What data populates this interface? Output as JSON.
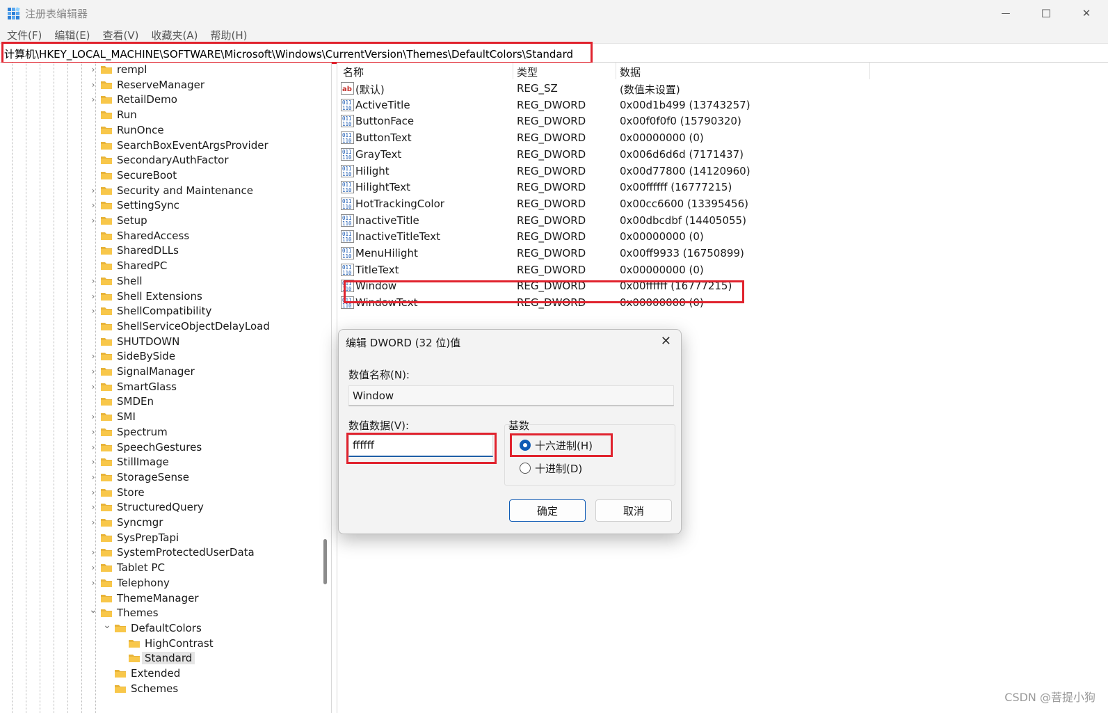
{
  "window": {
    "title": "注册表编辑器",
    "minimize_glyph": "—",
    "maximize_glyph": "☐",
    "close_glyph": "✕"
  },
  "menu": [
    {
      "label": "文件(F)"
    },
    {
      "label": "编辑(E)"
    },
    {
      "label": "查看(V)"
    },
    {
      "label": "收藏夹(A)"
    },
    {
      "label": "帮助(H)"
    }
  ],
  "address": {
    "path": "计算机\\HKEY_LOCAL_MACHINE\\SOFTWARE\\Microsoft\\Windows\\CurrentVersion\\Themes\\DefaultColors\\Standard"
  },
  "tree": [
    {
      "label": "rempl",
      "expander": "collapsed"
    },
    {
      "label": "ReserveManager",
      "expander": "collapsed"
    },
    {
      "label": "RetailDemo",
      "expander": "collapsed"
    },
    {
      "label": "Run",
      "expander": "none"
    },
    {
      "label": "RunOnce",
      "expander": "none"
    },
    {
      "label": "SearchBoxEventArgsProvider",
      "expander": "none"
    },
    {
      "label": "SecondaryAuthFactor",
      "expander": "none"
    },
    {
      "label": "SecureBoot",
      "expander": "none"
    },
    {
      "label": "Security and Maintenance",
      "expander": "collapsed"
    },
    {
      "label": "SettingSync",
      "expander": "collapsed"
    },
    {
      "label": "Setup",
      "expander": "collapsed"
    },
    {
      "label": "SharedAccess",
      "expander": "none"
    },
    {
      "label": "SharedDLLs",
      "expander": "none"
    },
    {
      "label": "SharedPC",
      "expander": "none"
    },
    {
      "label": "Shell",
      "expander": "collapsed"
    },
    {
      "label": "Shell Extensions",
      "expander": "collapsed"
    },
    {
      "label": "ShellCompatibility",
      "expander": "collapsed"
    },
    {
      "label": "ShellServiceObjectDelayLoad",
      "expander": "none"
    },
    {
      "label": "SHUTDOWN",
      "expander": "none"
    },
    {
      "label": "SideBySide",
      "expander": "collapsed"
    },
    {
      "label": "SignalManager",
      "expander": "collapsed"
    },
    {
      "label": "SmartGlass",
      "expander": "collapsed"
    },
    {
      "label": "SMDEn",
      "expander": "none"
    },
    {
      "label": "SMI",
      "expander": "collapsed"
    },
    {
      "label": "Spectrum",
      "expander": "collapsed"
    },
    {
      "label": "SpeechGestures",
      "expander": "collapsed"
    },
    {
      "label": "StillImage",
      "expander": "collapsed"
    },
    {
      "label": "StorageSense",
      "expander": "collapsed"
    },
    {
      "label": "Store",
      "expander": "collapsed"
    },
    {
      "label": "StructuredQuery",
      "expander": "collapsed"
    },
    {
      "label": "Syncmgr",
      "expander": "collapsed"
    },
    {
      "label": "SysPrepTapi",
      "expander": "none"
    },
    {
      "label": "SystemProtectedUserData",
      "expander": "collapsed"
    },
    {
      "label": "Tablet PC",
      "expander": "collapsed"
    },
    {
      "label": "Telephony",
      "expander": "collapsed"
    },
    {
      "label": "ThemeManager",
      "expander": "none"
    },
    {
      "label": "Themes",
      "expander": "expanded"
    },
    {
      "label": "DefaultColors",
      "expander": "expanded"
    },
    {
      "label": "HighContrast",
      "expander": "none"
    },
    {
      "label": "Standard",
      "expander": "none",
      "selected": true
    },
    {
      "label": "Extended",
      "expander": "none"
    },
    {
      "label": "Schemes",
      "expander": "none"
    }
  ],
  "list": {
    "columns": [
      {
        "label": "名称"
      },
      {
        "label": "类型"
      },
      {
        "label": "数据"
      }
    ],
    "rows": [
      {
        "icon": "string-value-icon",
        "name": "(默认)",
        "type": "REG_SZ",
        "data": "(数值未设置)"
      },
      {
        "icon": "dword-value-icon",
        "name": "ActiveTitle",
        "type": "REG_DWORD",
        "data": "0x00d1b499 (13743257)"
      },
      {
        "icon": "dword-value-icon",
        "name": "ButtonFace",
        "type": "REG_DWORD",
        "data": "0x00f0f0f0 (15790320)"
      },
      {
        "icon": "dword-value-icon",
        "name": "ButtonText",
        "type": "REG_DWORD",
        "data": "0x00000000 (0)"
      },
      {
        "icon": "dword-value-icon",
        "name": "GrayText",
        "type": "REG_DWORD",
        "data": "0x006d6d6d (7171437)"
      },
      {
        "icon": "dword-value-icon",
        "name": "Hilight",
        "type": "REG_DWORD",
        "data": "0x00d77800 (14120960)"
      },
      {
        "icon": "dword-value-icon",
        "name": "HilightText",
        "type": "REG_DWORD",
        "data": "0x00ffffff (16777215)"
      },
      {
        "icon": "dword-value-icon",
        "name": "HotTrackingColor",
        "type": "REG_DWORD",
        "data": "0x00cc6600 (13395456)"
      },
      {
        "icon": "dword-value-icon",
        "name": "InactiveTitle",
        "type": "REG_DWORD",
        "data": "0x00dbcdbf (14405055)"
      },
      {
        "icon": "dword-value-icon",
        "name": "InactiveTitleText",
        "type": "REG_DWORD",
        "data": "0x00000000 (0)"
      },
      {
        "icon": "dword-value-icon",
        "name": "MenuHilight",
        "type": "REG_DWORD",
        "data": "0x00ff9933 (16750899)"
      },
      {
        "icon": "dword-value-icon",
        "name": "TitleText",
        "type": "REG_DWORD",
        "data": "0x00000000 (0)"
      },
      {
        "icon": "dword-value-icon",
        "name": "Window",
        "type": "REG_DWORD",
        "data": "0x00ffffff (16777215)"
      },
      {
        "icon": "dword-value-icon",
        "name": "WindowText",
        "type": "REG_DWORD",
        "data": "0x00000000 (0)"
      }
    ]
  },
  "dialog": {
    "title": "编辑 DWORD (32 位)值",
    "name_label": "数值名称(N):",
    "name_value": "Window",
    "data_label": "数值数据(V):",
    "data_value": "ffffff",
    "base_label": "基数",
    "radio_hex": "十六进制(H)",
    "radio_dec": "十进制(D)",
    "selected_base": "hex",
    "ok_label": "确定",
    "cancel_label": "取消"
  },
  "colors": {
    "highlight_box": "#e0232e",
    "accent": "#0f5bb5",
    "folder": "#f8c74a"
  },
  "watermark": "CSDN @菩提小狗"
}
